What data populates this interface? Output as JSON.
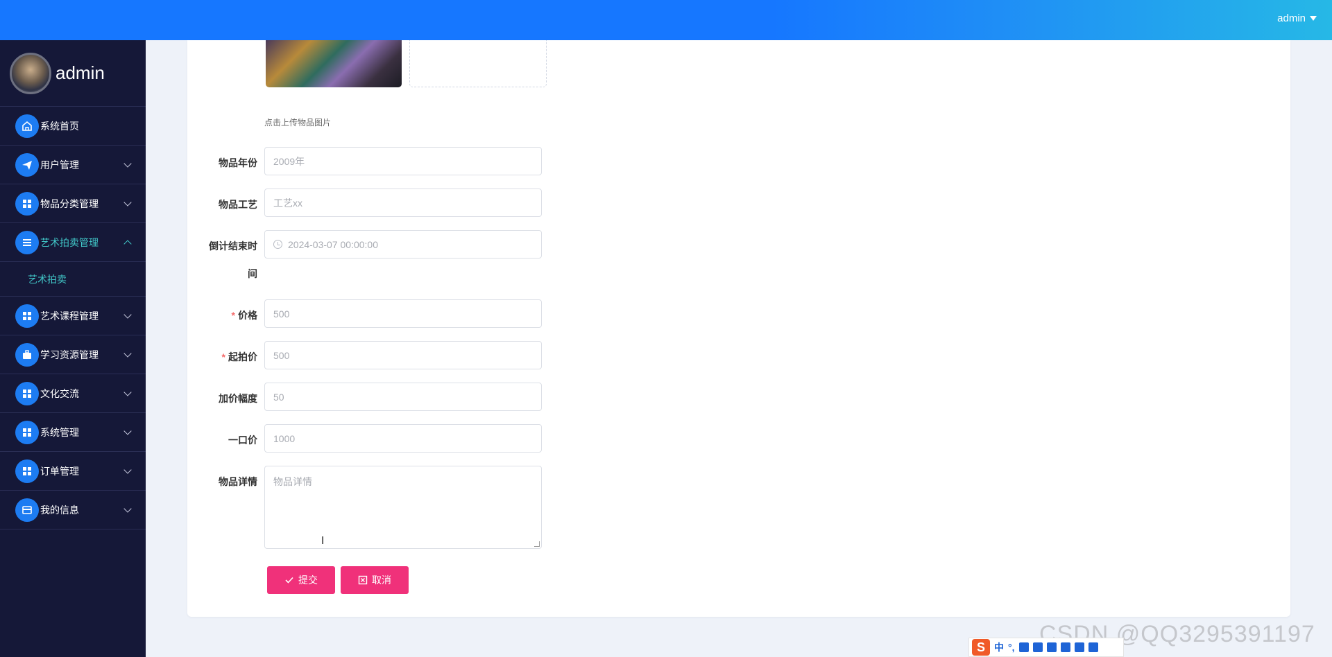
{
  "topbar": {
    "user_label": "admin"
  },
  "sidebar": {
    "profile_name": "admin",
    "items": [
      {
        "label": "系统首页",
        "icon": "home-icon"
      },
      {
        "label": "用户管理",
        "icon": "send-icon"
      },
      {
        "label": "物品分类管理",
        "icon": "grid-icon"
      },
      {
        "label": "艺术拍卖管理",
        "icon": "list-icon"
      },
      {
        "label": "艺术课程管理",
        "icon": "grid-icon"
      },
      {
        "label": "学习资源管理",
        "icon": "briefcase-icon"
      },
      {
        "label": "文化交流",
        "icon": "grid-icon"
      },
      {
        "label": "系统管理",
        "icon": "grid-icon"
      },
      {
        "label": "订单管理",
        "icon": "grid-icon"
      },
      {
        "label": "我的信息",
        "icon": "card-icon"
      }
    ],
    "sub_item": "艺术拍卖"
  },
  "form": {
    "upload_hint": "点击上传物品图片",
    "year_label": "物品年份",
    "year_value": "2009年",
    "craft_label": "物品工艺",
    "craft_value": "工艺xx",
    "deadline_label_1": "倒计结束时",
    "deadline_label_2": "间",
    "deadline_value": "2024-03-07 00:00:00",
    "price_label": "价格",
    "price_value": "500",
    "start_price_label": "起拍价",
    "start_price_value": "500",
    "increment_label": "加价幅度",
    "increment_value": "50",
    "buyout_label": "一口价",
    "buyout_value": "1000",
    "detail_label": "物品详情",
    "detail_placeholder": "物品详情",
    "required_mark": "*",
    "submit_label": "提交",
    "cancel_label": "取消"
  },
  "watermark": "CSDN @QQ3295391197",
  "ime": {
    "logo": "S",
    "lang": "中",
    "punct": "°,"
  }
}
